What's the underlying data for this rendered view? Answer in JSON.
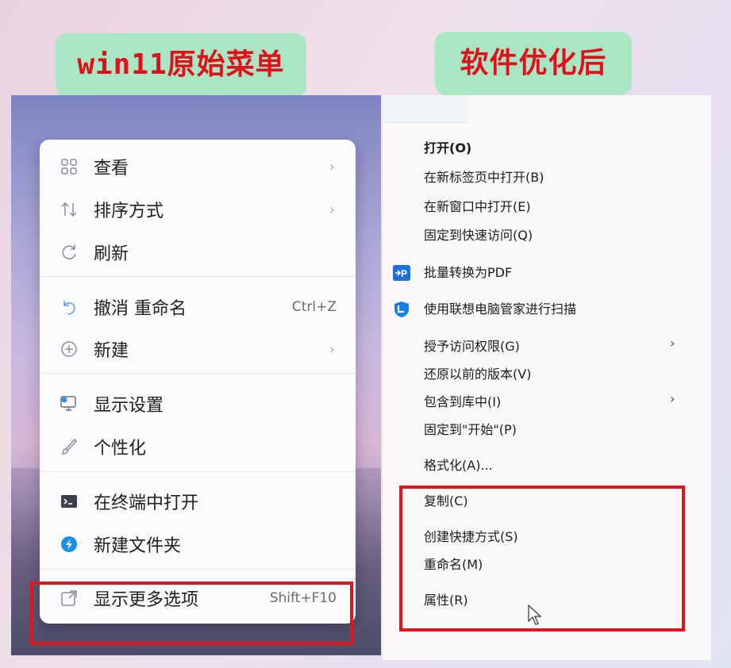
{
  "badges": {
    "left": "win11原始菜单",
    "right": "软件优化后"
  },
  "win11_menu": {
    "items": [
      {
        "label": "查看",
        "icon": "grid-view-icon",
        "shortcut": "",
        "has_submenu": true
      },
      {
        "label": "排序方式",
        "icon": "sort-arrows-icon",
        "shortcut": "",
        "has_submenu": true
      },
      {
        "label": "刷新",
        "icon": "refresh-icon",
        "shortcut": "",
        "has_submenu": false
      },
      {
        "label": "撤消 重命名",
        "icon": "undo-icon",
        "shortcut": "Ctrl+Z",
        "has_submenu": false
      },
      {
        "label": "新建",
        "icon": "new-plus-icon",
        "shortcut": "",
        "has_submenu": true
      },
      {
        "label": "显示设置",
        "icon": "display-settings-icon",
        "shortcut": "",
        "has_submenu": false
      },
      {
        "label": "个性化",
        "icon": "brush-icon",
        "shortcut": "",
        "has_submenu": false
      },
      {
        "label": "在终端中打开",
        "icon": "terminal-icon",
        "shortcut": "",
        "has_submenu": false
      },
      {
        "label": "新建文件夹",
        "icon": "new-folder-app-icon",
        "shortcut": "",
        "has_submenu": false
      },
      {
        "label": "显示更多选项",
        "icon": "show-more-options-icon",
        "shortcut": "Shift+F10",
        "has_submenu": false
      }
    ]
  },
  "classic_menu": {
    "items": [
      {
        "label": "打开(O)",
        "bold": true,
        "icon": "",
        "has_submenu": false
      },
      {
        "label": "在新标签页中打开(B)",
        "bold": false,
        "icon": "",
        "has_submenu": false
      },
      {
        "label": "在新窗口中打开(E)",
        "bold": false,
        "icon": "",
        "has_submenu": false
      },
      {
        "label": "固定到快速访问(Q)",
        "bold": false,
        "icon": "",
        "has_submenu": false
      },
      {
        "label": "批量转换为PDF",
        "bold": false,
        "icon": "pdf-convert-icon",
        "has_submenu": false
      },
      {
        "label": "使用联想电脑管家进行扫描",
        "bold": false,
        "icon": "lenovo-scan-icon",
        "has_submenu": false
      },
      {
        "label": "授予访问权限(G)",
        "bold": false,
        "icon": "",
        "has_submenu": true
      },
      {
        "label": "还原以前的版本(V)",
        "bold": false,
        "icon": "",
        "has_submenu": false
      },
      {
        "label": "包含到库中(I)",
        "bold": false,
        "icon": "",
        "has_submenu": true
      },
      {
        "label": "固定到\"开始\"(P)",
        "bold": false,
        "icon": "",
        "has_submenu": false
      },
      {
        "label": "格式化(A)...",
        "bold": false,
        "icon": "",
        "has_submenu": false
      },
      {
        "label": "复制(C)",
        "bold": false,
        "icon": "",
        "has_submenu": false
      },
      {
        "label": "创建快捷方式(S)",
        "bold": false,
        "icon": "",
        "has_submenu": false
      },
      {
        "label": "重命名(M)",
        "bold": false,
        "icon": "",
        "has_submenu": false
      },
      {
        "label": "属性(R)",
        "bold": false,
        "icon": "",
        "has_submenu": false
      }
    ]
  },
  "colors": {
    "highlight_red": "#e2141c",
    "badge_green": "#a9e6c4",
    "badge_text": "#e10f1a"
  }
}
